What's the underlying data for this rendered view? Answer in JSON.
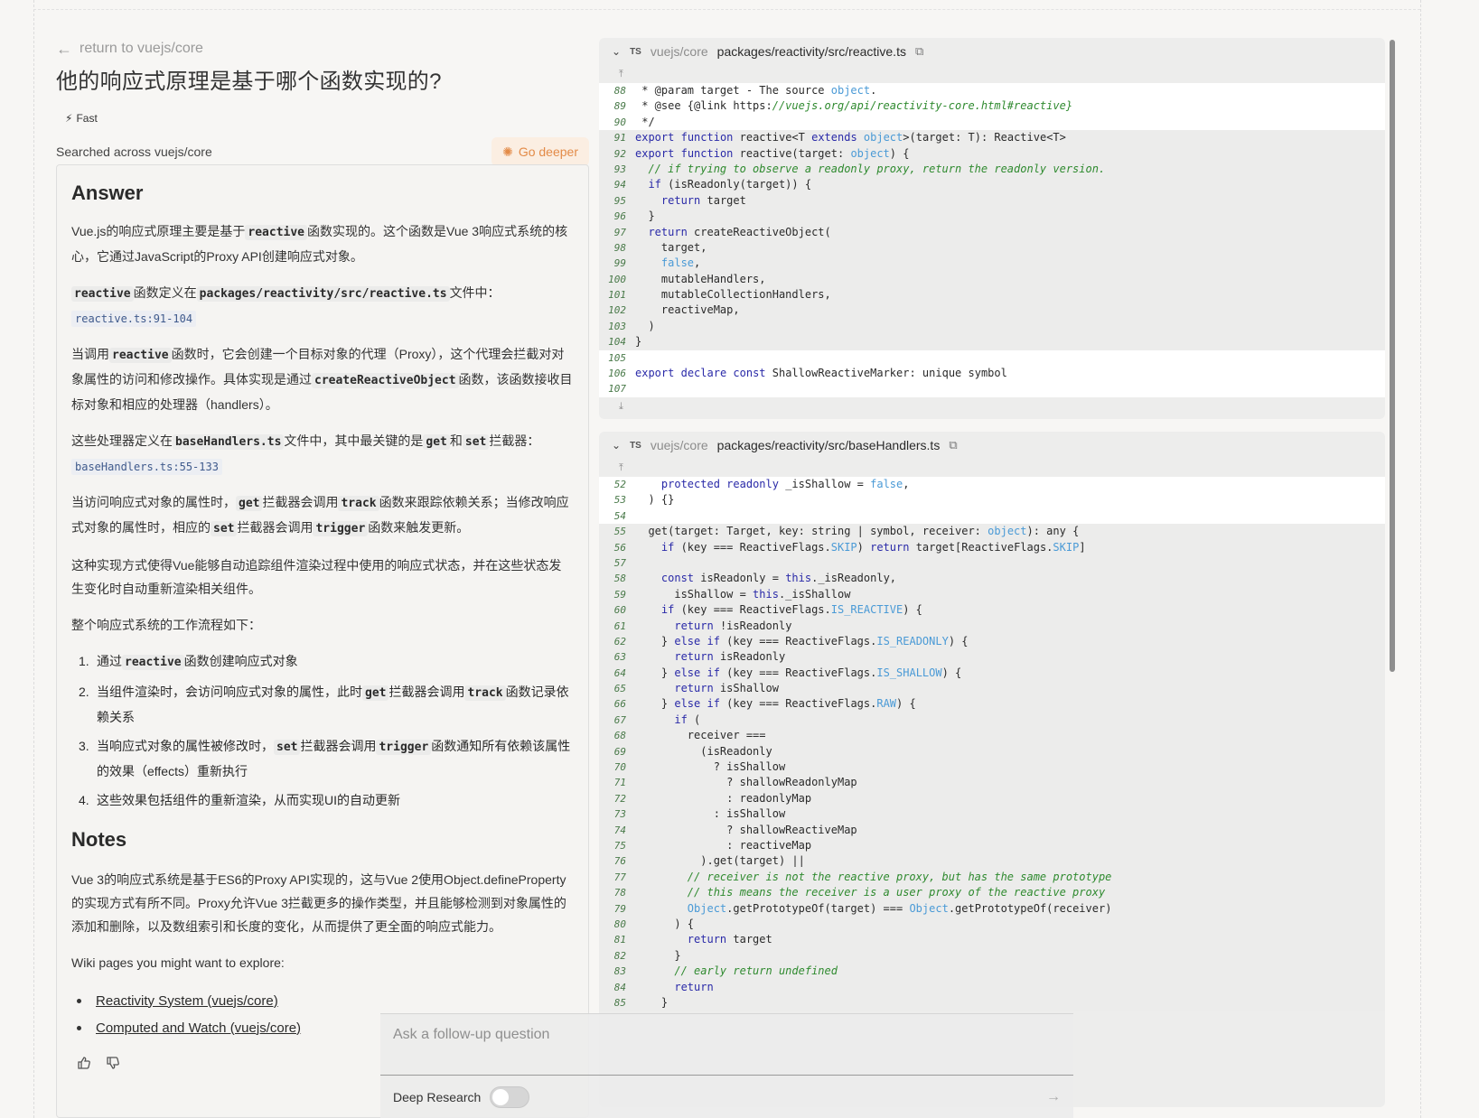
{
  "back_link": "return to vuejs/core",
  "title": "他的响应式原理是基于哪个函数实现的?",
  "mode_badge": "Fast",
  "searched": "Searched across vuejs/core",
  "go_deeper": "Go deeper",
  "answer": {
    "heading": "Answer",
    "p1_a": "Vue.js的响应式原理主要是基于",
    "p1_code": "reactive",
    "p1_b": "函数实现的。这个函数是Vue 3响应式系统的核心，它通过JavaScript的Proxy API创建响应式对象。",
    "p2_code1": "reactive",
    "p2_a": "函数定义在",
    "p2_code2": "packages/reactivity/src/reactive.ts",
    "p2_b": "文件中：",
    "ref1": "reactive.ts:91-104",
    "p3_a": "当调用",
    "p3_code1": "reactive",
    "p3_b": "函数时，它会创建一个目标对象的代理（Proxy），这个代理会拦截对对象属性的访问和修改操作。具体实现是通过",
    "p3_code2": "createReactiveObject",
    "p3_c": "函数，该函数接收目标对象和相应的处理器（handlers）。",
    "p4_a": "这些处理器定义在",
    "p4_code1": "baseHandlers.ts",
    "p4_b": "文件中，其中最关键的是",
    "p4_code2": "get",
    "p4_c": "和",
    "p4_code3": "set",
    "p4_d": "拦截器：",
    "ref2": "baseHandlers.ts:55-133",
    "p5_a": "当访问响应式对象的属性时，",
    "p5_code1": "get",
    "p5_b": "拦截器会调用",
    "p5_code2": "track",
    "p5_c": "函数来跟踪依赖关系；当修改响应式对象的属性时，相应的",
    "p5_code3": "set",
    "p5_d": "拦截器会调用",
    "p5_code4": "trigger",
    "p5_e": "函数来触发更新。",
    "p6": "这种实现方式使得Vue能够自动追踪组件渲染过程中使用的响应式状态，并在这些状态发生变化时自动重新渲染相关组件。",
    "p7": "整个响应式系统的工作流程如下：",
    "steps": [
      {
        "num": "1.",
        "a": "通过",
        "code": "reactive",
        "b": "函数创建响应式对象"
      },
      {
        "num": "2.",
        "a": "当组件渲染时，会访问响应式对象的属性，此时",
        "code": "get",
        "b": "拦截器会调用",
        "code2": "track",
        "c": "函数记录依赖关系"
      },
      {
        "num": "3.",
        "a": "当响应式对象的属性被修改时，",
        "code": "set",
        "b": "拦截器会调用",
        "code2": "trigger",
        "c": "函数通知所有依赖该属性的效果（effects）重新执行"
      },
      {
        "num": "4.",
        "a": "这些效果包括组件的重新渲染，从而实现UI的自动更新"
      }
    ],
    "notes_heading": "Notes",
    "notes_p": "Vue 3的响应式系统是基于ES6的Proxy API实现的，这与Vue 2使用Object.defineProperty的实现方式有所不同。Proxy允许Vue 3拦截更多的操作类型，并且能够检测到对象属性的添加和删除，以及数组索引和长度的变化，从而提供了更全面的响应式能力。",
    "wiki_intro": "Wiki pages you might want to explore:",
    "wiki_links": [
      "Reactivity System (vuejs/core)",
      "Computed and Watch (vuejs/core)"
    ]
  },
  "code_panels": [
    {
      "lang": "TS",
      "repo": "vuejs/core",
      "path": "packages/reactivity/src/reactive.ts"
    },
    {
      "lang": "TS",
      "repo": "vuejs/core",
      "path": "packages/reactivity/src/baseHandlers.ts"
    }
  ],
  "followup": {
    "placeholder": "Ask a follow-up question",
    "deep_research": "Deep Research"
  },
  "icons": {
    "back": "arrow-left-icon",
    "fast": "lightning-icon",
    "deeper": "sparkle-icon",
    "collapse": "chevron-down-icon",
    "copy": "copy-icon",
    "expand_up": "expand-up-icon",
    "expand_down": "expand-down-icon",
    "thumbs_up": "thumbs-up-icon",
    "thumbs_down": "thumbs-down-icon",
    "send": "arrow-right-icon"
  },
  "colors": {
    "accent": "#e38b48",
    "accent_bg": "#fbeee2",
    "keyword": "#2a2aa8",
    "comment": "#2f8a2f"
  },
  "code_lines_1": [
    {
      "n": "88",
      "ctx": true,
      "t": " * @param target - The source object."
    },
    {
      "n": "89",
      "ctx": true,
      "t": " * @see {@link https://vuejs.org/api/reactivity-core.html#reactive}"
    },
    {
      "n": "90",
      "ctx": true,
      "t": " */"
    },
    {
      "n": "91",
      "ctx": false,
      "t": "export function reactive<T extends object>(target: T): Reactive<T>"
    },
    {
      "n": "92",
      "ctx": false,
      "t": "export function reactive(target: object) {"
    },
    {
      "n": "93",
      "ctx": false,
      "t": "  // if trying to observe a readonly proxy, return the readonly version."
    },
    {
      "n": "94",
      "ctx": false,
      "t": "  if (isReadonly(target)) {"
    },
    {
      "n": "95",
      "ctx": false,
      "t": "    return target"
    },
    {
      "n": "96",
      "ctx": false,
      "t": "  }"
    },
    {
      "n": "97",
      "ctx": false,
      "t": "  return createReactiveObject("
    },
    {
      "n": "98",
      "ctx": false,
      "t": "    target,"
    },
    {
      "n": "99",
      "ctx": false,
      "t": "    false,"
    },
    {
      "n": "100",
      "ctx": false,
      "t": "    mutableHandlers,"
    },
    {
      "n": "101",
      "ctx": false,
      "t": "    mutableCollectionHandlers,"
    },
    {
      "n": "102",
      "ctx": false,
      "t": "    reactiveMap,"
    },
    {
      "n": "103",
      "ctx": false,
      "t": "  )"
    },
    {
      "n": "104",
      "ctx": false,
      "t": "}"
    },
    {
      "n": "105",
      "ctx": true,
      "t": ""
    },
    {
      "n": "106",
      "ctx": true,
      "t": "export declare const ShallowReactiveMarker: unique symbol"
    },
    {
      "n": "107",
      "ctx": true,
      "t": ""
    }
  ],
  "code_lines_2": [
    {
      "n": "52",
      "ctx": true,
      "t": "    protected readonly _isShallow = false,"
    },
    {
      "n": "53",
      "ctx": true,
      "t": "  ) {}"
    },
    {
      "n": "54",
      "ctx": true,
      "t": ""
    },
    {
      "n": "55",
      "ctx": false,
      "t": "  get(target: Target, key: string | symbol, receiver: object): any {"
    },
    {
      "n": "56",
      "ctx": false,
      "t": "    if (key === ReactiveFlags.SKIP) return target[ReactiveFlags.SKIP]"
    },
    {
      "n": "57",
      "ctx": false,
      "t": ""
    },
    {
      "n": "58",
      "ctx": false,
      "t": "    const isReadonly = this._isReadonly,"
    },
    {
      "n": "59",
      "ctx": false,
      "t": "      isShallow = this._isShallow"
    },
    {
      "n": "60",
      "ctx": false,
      "t": "    if (key === ReactiveFlags.IS_REACTIVE) {"
    },
    {
      "n": "61",
      "ctx": false,
      "t": "      return !isReadonly"
    },
    {
      "n": "62",
      "ctx": false,
      "t": "    } else if (key === ReactiveFlags.IS_READONLY) {"
    },
    {
      "n": "63",
      "ctx": false,
      "t": "      return isReadonly"
    },
    {
      "n": "64",
      "ctx": false,
      "t": "    } else if (key === ReactiveFlags.IS_SHALLOW) {"
    },
    {
      "n": "65",
      "ctx": false,
      "t": "      return isShallow"
    },
    {
      "n": "66",
      "ctx": false,
      "t": "    } else if (key === ReactiveFlags.RAW) {"
    },
    {
      "n": "67",
      "ctx": false,
      "t": "      if ("
    },
    {
      "n": "68",
      "ctx": false,
      "t": "        receiver ==="
    },
    {
      "n": "69",
      "ctx": false,
      "t": "          (isReadonly"
    },
    {
      "n": "70",
      "ctx": false,
      "t": "            ? isShallow"
    },
    {
      "n": "71",
      "ctx": false,
      "t": "              ? shallowReadonlyMap"
    },
    {
      "n": "72",
      "ctx": false,
      "t": "              : readonlyMap"
    },
    {
      "n": "73",
      "ctx": false,
      "t": "            : isShallow"
    },
    {
      "n": "74",
      "ctx": false,
      "t": "              ? shallowReactiveMap"
    },
    {
      "n": "75",
      "ctx": false,
      "t": "              : reactiveMap"
    },
    {
      "n": "76",
      "ctx": false,
      "t": "          ).get(target) ||"
    },
    {
      "n": "77",
      "ctx": false,
      "t": "        // receiver is not the reactive proxy, but has the same prototype"
    },
    {
      "n": "78",
      "ctx": false,
      "t": "        // this means the receiver is a user proxy of the reactive proxy"
    },
    {
      "n": "79",
      "ctx": false,
      "t": "        Object.getPrototypeOf(target) === Object.getPrototypeOf(receiver)"
    },
    {
      "n": "80",
      "ctx": false,
      "t": "      ) {"
    },
    {
      "n": "81",
      "ctx": false,
      "t": "        return target"
    },
    {
      "n": "82",
      "ctx": false,
      "t": "      }"
    },
    {
      "n": "83",
      "ctx": false,
      "t": "      // early return undefined"
    },
    {
      "n": "84",
      "ctx": false,
      "t": "      return"
    },
    {
      "n": "85",
      "ctx": false,
      "t": "    }"
    }
  ]
}
